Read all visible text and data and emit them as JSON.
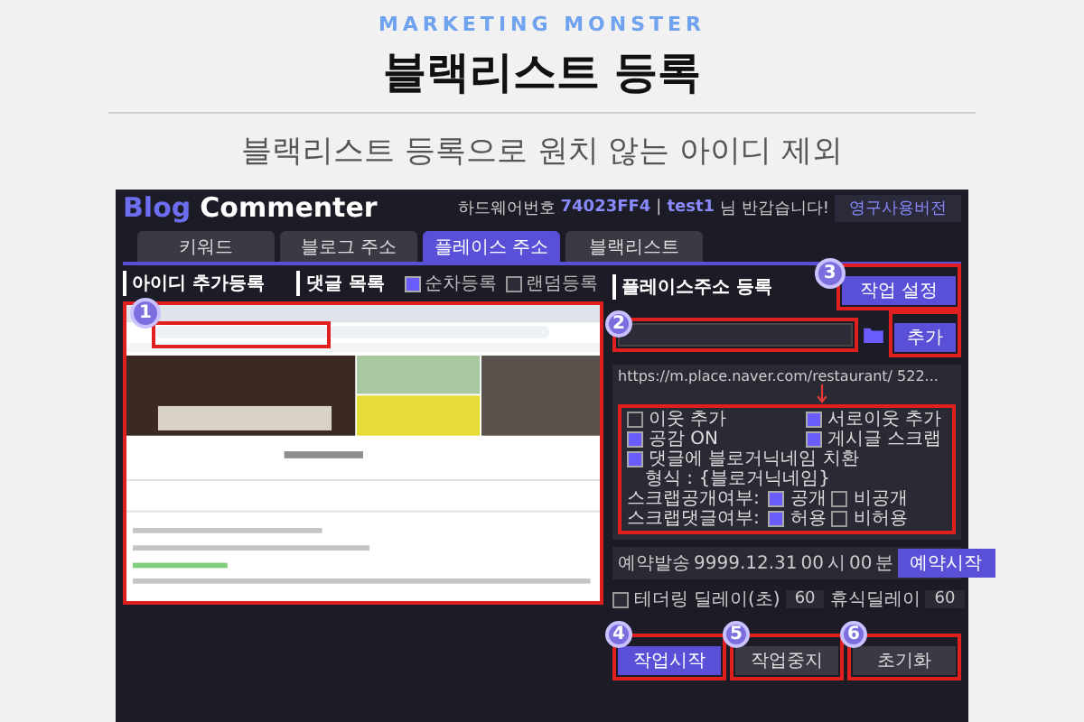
{
  "header": {
    "eyebrow": "MARKETING MONSTER",
    "title": "블랙리스트 등록",
    "subtitle": "블랙리스트 등록으로 원치 않는 아이디 제외"
  },
  "app": {
    "logo_part1": "Blog",
    "logo_part2": "Commenter",
    "hardware_label": "하드웨어번호",
    "hardware_id": "74023FF4",
    "separator": "|",
    "user": "test1",
    "greeting": "님 반갑습니다!",
    "license_button": "영구사용버전",
    "tabs": [
      {
        "label": "키워드",
        "selected": false
      },
      {
        "label": "블로그 주소",
        "selected": false
      },
      {
        "label": "플레이스 주소",
        "selected": true
      },
      {
        "label": "블랙리스트",
        "selected": false
      }
    ],
    "left_panel": {
      "title": "아이디 추가등록",
      "comments_title": "댓글 목록",
      "order_options": [
        {
          "label": "순차등록",
          "selected": true
        },
        {
          "label": "랜덤등록",
          "selected": false
        }
      ],
      "step": "1"
    },
    "right_panel": {
      "title": "플레이스주소 등록",
      "settings_button": "작업 설정",
      "settings_step": "3",
      "field_step": "2",
      "add_button": "추가",
      "urls": [
        "https://m.place.naver.com/restaurant/ 522..."
      ],
      "options": [
        {
          "kind": "checks",
          "items": [
            {
              "label": "이웃 추가",
              "checked": false
            },
            {
              "label": "서로이웃 추가",
              "checked": true
            }
          ]
        },
        {
          "kind": "checks",
          "items": [
            {
              "label": "공감 ON",
              "checked": true
            },
            {
              "label": "게시글 스크랩",
              "checked": true
            }
          ]
        },
        {
          "kind": "checks",
          "items": [
            {
              "label": "댓글에 블로거닉네임 치환",
              "checked": true
            }
          ],
          "note": "형식 : {블로거닉네임}"
        },
        {
          "kind": "radio",
          "label": "스크랩공개여부:",
          "items": [
            {
              "label": "공개",
              "selected": true
            },
            {
              "label": "비공개",
              "selected": false
            }
          ]
        },
        {
          "kind": "radio",
          "label": "스크랩댓글여부:",
          "items": [
            {
              "label": "허용",
              "selected": true
            },
            {
              "label": "비허용",
              "selected": false
            }
          ]
        }
      ],
      "schedule": {
        "label": "예약발송",
        "date": "9999.12.31",
        "hour": "00",
        "hour_unit": "시",
        "minute": "00",
        "minute_unit": "분",
        "button": "예약시작"
      },
      "tethering": {
        "label": "테더링",
        "checked": false
      },
      "delay": {
        "label": "딜레이(초)",
        "value": "60"
      },
      "rest_delay": {
        "label": "휴식딜레이",
        "value": "60"
      },
      "actions": [
        {
          "label": "작업시작",
          "step": "4",
          "primary": true
        },
        {
          "label": "작업중지",
          "step": "5",
          "primary": false
        },
        {
          "label": "초기화",
          "step": "6",
          "primary": false
        }
      ]
    }
  }
}
